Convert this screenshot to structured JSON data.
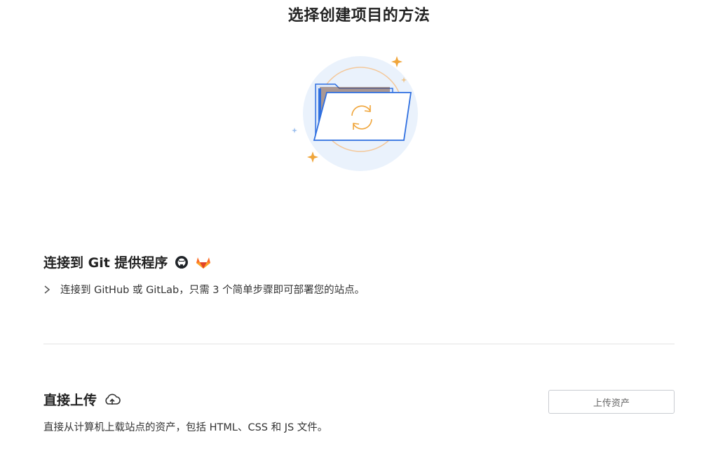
{
  "page": {
    "title": "选择创建项目的方法"
  },
  "git_section": {
    "title": "连接到 Git 提供程序",
    "description": "连接到 GitHub 或 GitLab，只需 3 个简单步骤即可部署您的站点。",
    "icons": [
      "github-icon",
      "gitlab-icon"
    ]
  },
  "upload_section": {
    "title": "直接上传",
    "description": "直接从计算机上载站点的资产，包括 HTML、CSS 和 JS 文件。",
    "button_label": "上传资产",
    "icon": "cloud-upload-icon"
  },
  "colors": {
    "accent_blue": "#2f6fe0",
    "hero_circle": "#eaf2fc",
    "sparkle_orange": "#f0a53a",
    "gitlab_orange": "#fc6d26"
  }
}
